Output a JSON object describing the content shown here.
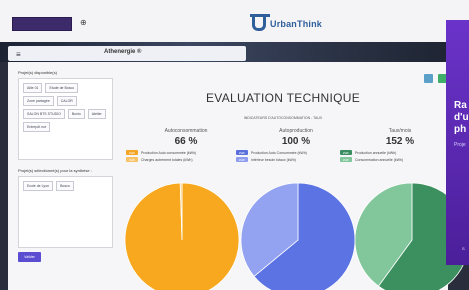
{
  "header": {
    "brand": "UrbanThink",
    "top_icon": "⊕"
  },
  "subnav": {
    "menu_icon": "≡",
    "title": "Athenergie ®"
  },
  "left_panel": {
    "projects_title": "Projet(s) disponible(s)",
    "projects": [
      "Allie 01",
      "Etude de Bosco",
      "Zone partagée",
      "CALOR",
      "SALON BTS STUDIO",
      "Bonlo",
      "Atelier",
      "Entrepôt rue"
    ],
    "selected_title": "Projet(s) sélectionné(s) pour la synthèse :",
    "selected": [
      "Ecole de Lyon",
      "Bosco"
    ],
    "apply_label": "Valider"
  },
  "main": {
    "title": "EVALUATION TECHNIQUE",
    "subtitle": "INDICATEURS D'AUTOCONSOMMATION - TAUX",
    "columns": [
      {
        "label": "Autoconsommation",
        "value": "66 %",
        "legend": [
          {
            "tag": "kWh",
            "text": "Production Auto consommée (kWh)",
            "color": "#f4a524"
          },
          {
            "tag": "kWh",
            "text": "Charges autrement totales (kWh)",
            "color": "#f7c266"
          }
        ],
        "slices": [
          {
            "label": "Production Auto consommée",
            "fraction": 0.995,
            "color": "#f7a81e"
          },
          {
            "label": "Charges autrement totales",
            "fraction": 0.005,
            "color": "#f8c86a"
          }
        ]
      },
      {
        "label": "Autoproduction",
        "value": "100 %",
        "legend": [
          {
            "tag": "kWh",
            "text": "Production Auto Consommée (kWh)",
            "color": "#5a6fdc"
          },
          {
            "tag": "kWh",
            "text": "Intérieur besoin totaux (kWh)",
            "color": "#8e9cf0"
          }
        ],
        "slices": [
          {
            "label": "Production Auto Consommée",
            "fraction": 0.64,
            "color": "#5b73e3"
          },
          {
            "label": "Intérieur besoin totaux",
            "fraction": 0.36,
            "color": "#93a3f2"
          }
        ]
      },
      {
        "label": "Taux/mois",
        "value": "152 %",
        "legend": [
          {
            "tag": "kWh",
            "text": "Production annuelle (kWh)",
            "color": "#3a8f62"
          },
          {
            "tag": "kWh",
            "text": "Consommation annuelle (kWh)",
            "color": "#7fc79a"
          }
        ],
        "slices": [
          {
            "label": "Production annuelle",
            "fraction": 0.6,
            "color": "#3c8f5f"
          },
          {
            "label": "Consommation annuelle",
            "fraction": 0.4,
            "color": "#82c79b"
          }
        ]
      }
    ]
  },
  "side_ad": {
    "headline": "Ra d'u ph",
    "sub": "Proje",
    "more": "S"
  },
  "colors": {
    "brand": "#2f5f9a",
    "accent": "#5b4dd1",
    "ad": "#6b33c9"
  }
}
